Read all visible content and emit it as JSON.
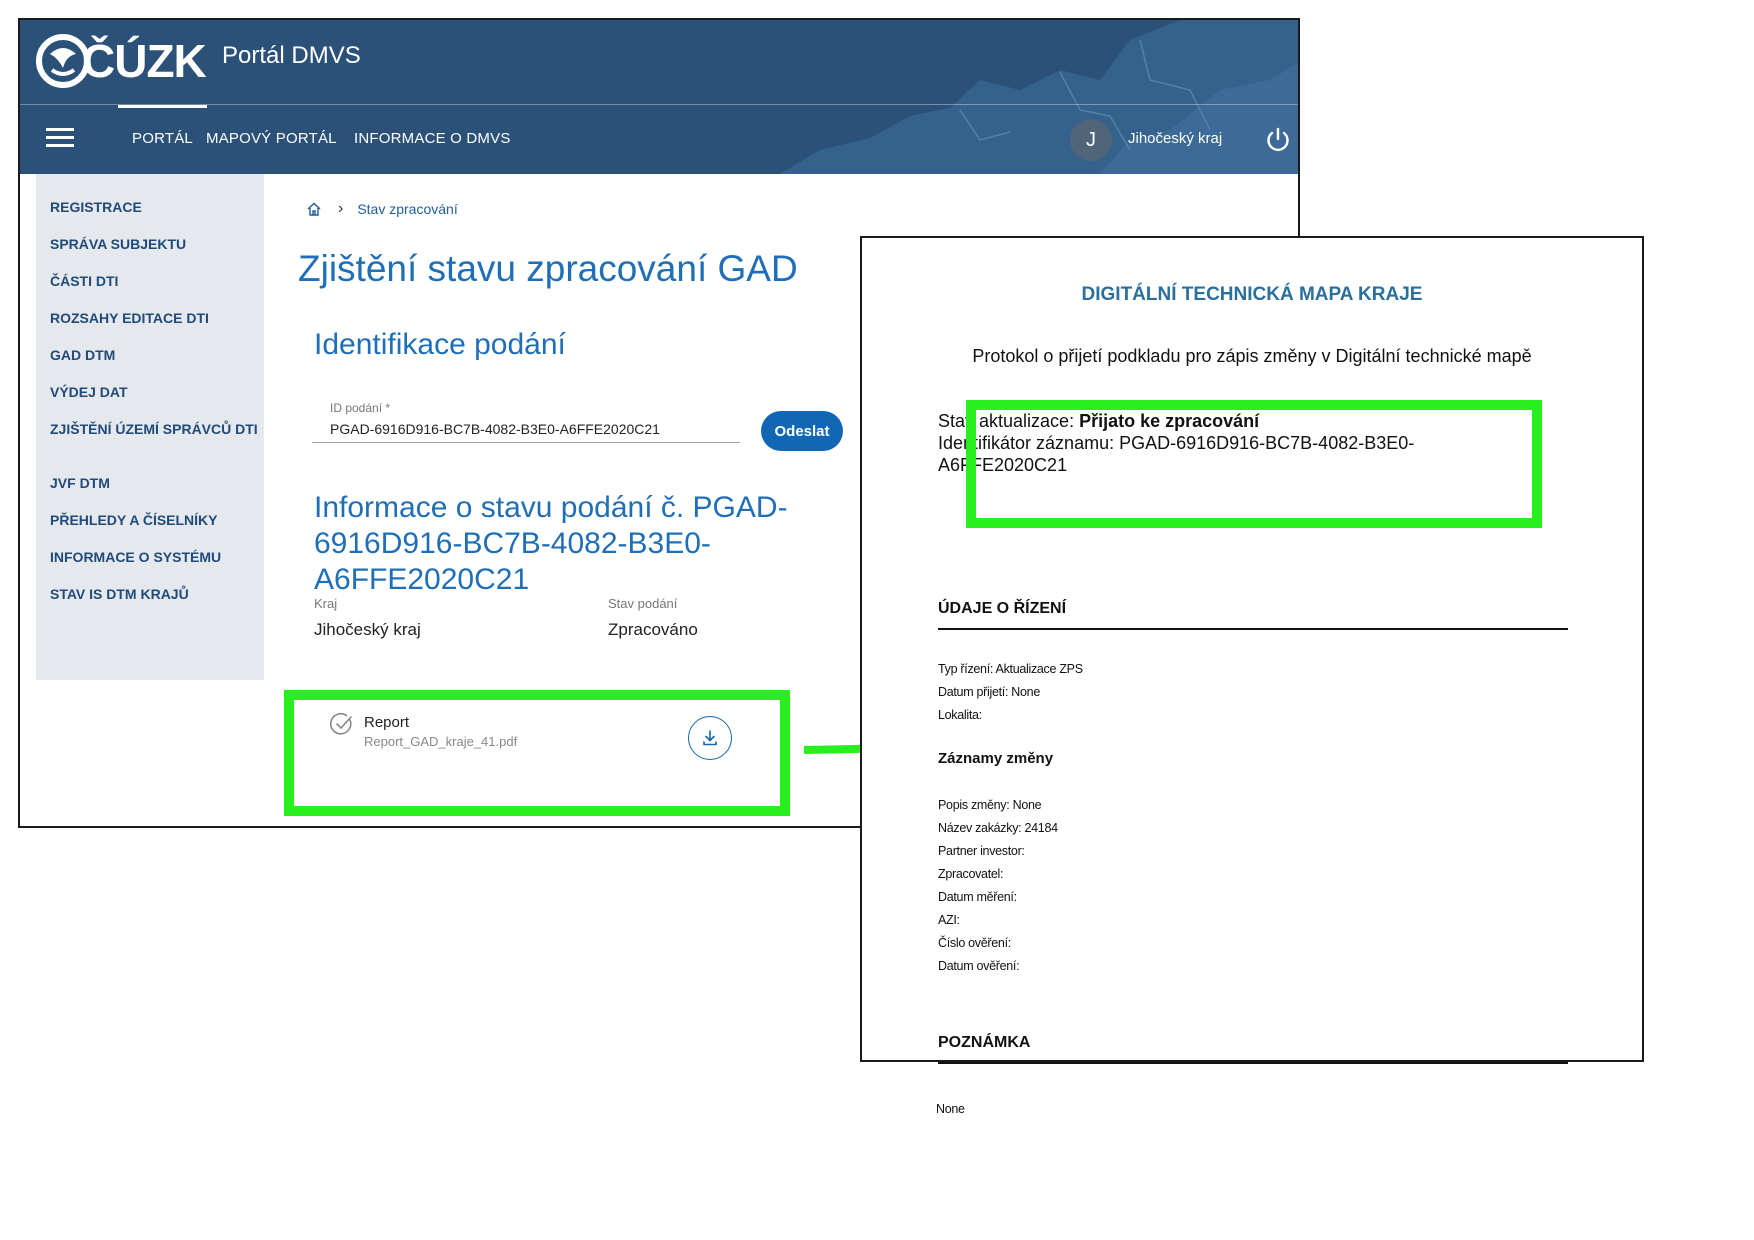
{
  "header": {
    "logo_text": "ČÚZK",
    "app_title": "Portál DMVS",
    "nav": [
      "PORTÁL",
      "MAPOVÝ PORTÁL",
      "INFORMACE O DMVS"
    ],
    "user_initial": "J",
    "user_name": "Jihočeský kraj",
    "brand_color": "#2b5179"
  },
  "sidebar": {
    "items": [
      "REGISTRACE",
      "SPRÁVA SUBJEKTU",
      "ČÁSTI DTI",
      "ROZSAHY EDITACE DTI",
      "GAD DTM",
      "VÝDEJ DAT",
      "ZJIŠTĚNÍ ÚZEMÍ SPRÁVCŮ DTI",
      "JVF DTM",
      "PŘEHLEDY A ČÍSELNÍKY",
      "INFORMACE O SYSTÉMU",
      "STAV IS DTM KRAJŮ"
    ]
  },
  "main": {
    "breadcrumb": "Stav zpracování",
    "page_title": "Zjištění stavu zpracování GAD",
    "ident_title": "Identifikace podání",
    "id_label": "ID podání *",
    "id_value": "PGAD-6916D916-BC7B-4082-B3E0-A6FFE2020C21",
    "send_label": "Odeslat",
    "info_title": "Informace o stavu podání č. PGAD-6916D916-BC7B-4082-B3E0-A6FFE2020C21",
    "kraj_label": "Kraj",
    "kraj_value": "Jihočeský kraj",
    "stav_label": "Stav podání",
    "stav_value": "Zpracováno",
    "report_title": "Report",
    "report_file": "Report_GAD_kraje_41.pdf"
  },
  "document": {
    "title": "DIGITÁLNÍ TECHNICKÁ MAPA KRAJE",
    "subtitle": "Protokol o přijetí podkladu pro zápis změny v Digitální technické mapě",
    "status_label": "Stav aktualizace: ",
    "status_value": "Přijato ke zpracování",
    "record_id": "Identifikátor záznamu: PGAD-6916D916-BC7B-4082-B3E0-A6FFE2020C21",
    "section1": "ÚDAJE O ŘÍZENÍ",
    "section1_lines": [
      "Typ řízení: Aktualizace ZPS",
      "Datum přijetí: None",
      "Lokalita:"
    ],
    "section2": "Záznamy změny",
    "section2_lines": [
      "Popis změny: None",
      "Název zakázky: 24184",
      "Partner investor:",
      "Zpracovatel:",
      "Datum měření:",
      "AZI:",
      "Číslo ověření:",
      "Datum ověření:"
    ],
    "section3": "POZNÁMKA",
    "section3_value": "None"
  },
  "highlight_color": "#27f01e"
}
